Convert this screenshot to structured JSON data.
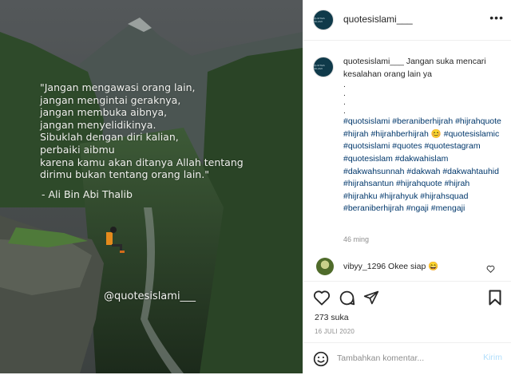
{
  "post": {
    "quote_text": "\"Jangan mengawasi orang lain,\njangan mengintai geraknya,\njangan membuka aibnya,\njangan menyelidikinya.\nSibuklah dengan diri kalian,\nperbaiki aibmu\nkarena kamu akan ditanya Allah tentang\ndirimu bukan tentang orang lain.\"",
    "author": "- Ali Bin Abi Thalib",
    "watermark": "@quotesislami___"
  },
  "header": {
    "avatar_text": "QUOTES ISLAMI",
    "username": "quotesislami___",
    "more_icon": "more-options-icon"
  },
  "caption": {
    "username": "quotesislami___",
    "text": "Jangan suka mencari kesalahan orang lain ya",
    "dots": [
      ".",
      ".",
      ".",
      "."
    ],
    "tags_1": "#quotsislami #beraniberhijrah #hijrahquote #hijrah #hijrahberhijrah",
    "emoji": "😊",
    "tags_2": "#quotesislamic #quotsislami #quotes #quotestagram #quotesislam #dakwahislam #dakwahsunnah #dakwah #dakwahtauhid #hijrahsantun #hijrahquote #hijrah #hijrahku #hijrahyuk #hijrahsquad #beraniberhijrah #ngaji #mengaji",
    "time": "46 ming"
  },
  "reply": {
    "username": "vibyy_1296",
    "text": "Okee siap",
    "emoji": "😄"
  },
  "actions": {
    "icons": [
      "heart-icon",
      "comment-icon",
      "share-icon",
      "bookmark-icon"
    ],
    "likes": "273 suka",
    "date": "16 JULI 2020"
  },
  "comment_box": {
    "placeholder": "Tambahkan komentar...",
    "post_label": "Kirim"
  },
  "colors": {
    "link": "#00376b",
    "muted": "#8e8e8e",
    "post_disabled": "#b2dffc"
  }
}
